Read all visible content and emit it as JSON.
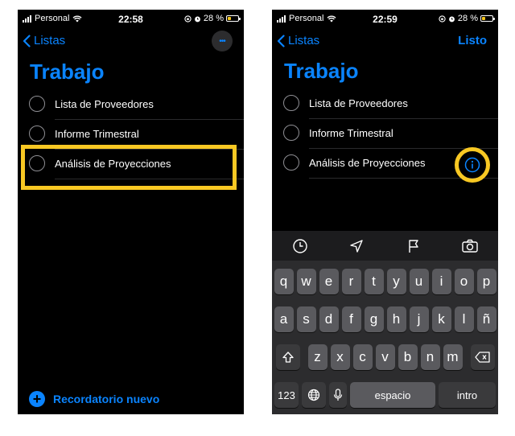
{
  "status": {
    "left": {
      "carrier": "Personal",
      "time": "22:58",
      "battery": "28 %"
    },
    "right": {
      "carrier": "Personal",
      "time": "22:59",
      "battery": "28 %"
    }
  },
  "nav": {
    "back_label": "Listas",
    "more_label": "•••",
    "done_label": "Listo"
  },
  "list": {
    "title": "Trabajo",
    "items": [
      {
        "label": "Lista de Proveedores"
      },
      {
        "label": "Informe Trimestral"
      },
      {
        "label": "Análisis de Proyecciones"
      }
    ]
  },
  "footer": {
    "new_reminder": "Recordatorio nuevo"
  },
  "toolbar": {
    "icons": [
      "clock-icon",
      "location-arrow-icon",
      "flag-icon",
      "camera-icon"
    ]
  },
  "keyboard": {
    "row1": [
      "q",
      "w",
      "e",
      "r",
      "t",
      "y",
      "u",
      "i",
      "o",
      "p"
    ],
    "row2": [
      "a",
      "s",
      "d",
      "f",
      "g",
      "h",
      "j",
      "k",
      "l",
      "ñ"
    ],
    "row3": [
      "z",
      "x",
      "c",
      "v",
      "b",
      "n",
      "m"
    ],
    "numbers_key": "123",
    "space_key": "espacio",
    "return_key": "intro"
  },
  "colors": {
    "accent": "#0a84ff",
    "highlight": "#f8c823",
    "battery": "#f5c518"
  }
}
